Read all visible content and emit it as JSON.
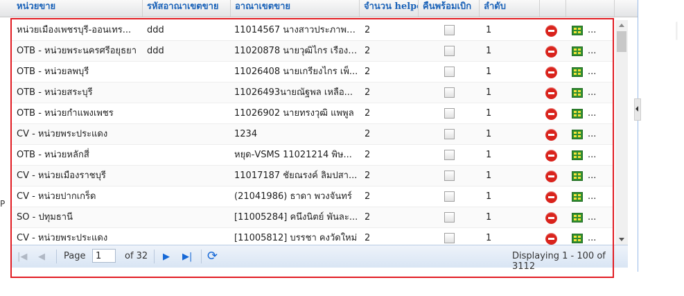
{
  "columns": [
    {
      "label": "หน่วยขาย"
    },
    {
      "label": "รหัสอาณาเขตขาย"
    },
    {
      "label": "อาณาเขตขาย"
    },
    {
      "label": "จำนวน helpe"
    },
    {
      "label": "คืนพร้อมเบิก"
    },
    {
      "label": "ลำดับ"
    }
  ],
  "rows": [
    {
      "unit": "หน่วยเมืองเพชรบุรี-ออนเทร...",
      "code": "ddd",
      "area": "11014567 นางสาวประภาพร...",
      "helper": "2",
      "order": "1"
    },
    {
      "unit": "OTB - หน่วยพระนครศรีอยุธยา",
      "code": "ddd",
      "area": "11020878 นายวุฒิไกร เรืองเ...",
      "helper": "2",
      "order": "1"
    },
    {
      "unit": "OTB - หน่วยลพบุรี",
      "code": "",
      "area": "11026408 นายเกรียงไกร เพ็...",
      "helper": "2",
      "order": "1"
    },
    {
      "unit": "OTB - หน่วยสระบุรี",
      "code": "",
      "area": "11026493นายณัฐพล เหลือ...",
      "helper": "2",
      "order": "1"
    },
    {
      "unit": "OTB - หน่วยกำแพงเพชร",
      "code": "",
      "area": "11026902 นายทรงวุฒิ แพพูล",
      "helper": "2",
      "order": "1"
    },
    {
      "unit": "CV - หน่วยพระประแดง",
      "code": "",
      "area": "1234",
      "helper": "2",
      "order": "1"
    },
    {
      "unit": "OTB - หน่วยหลักสี่",
      "code": "",
      "area": "หยุด-VSMS 11021214 พิษ...",
      "helper": "2",
      "order": "1"
    },
    {
      "unit": "CV - หน่วยเมืองราชบุรี",
      "code": "",
      "area": "11017187 ชัยณรงค์ ลิมปสา...",
      "helper": "2",
      "order": "1"
    },
    {
      "unit": "CV - หน่วยปากเกร็ด",
      "code": "",
      "area": "(21041986) ธาดา พวงจันทร์",
      "helper": "2",
      "order": "1"
    },
    {
      "unit": "SO - ปทุมธานี",
      "code": "",
      "area": "[11005284] คนึงนิตย์ พันละ...",
      "helper": "2",
      "order": "1"
    },
    {
      "unit": "CV - หน่วยพระประแดง",
      "code": "",
      "area": "[11005812] บรรชา คงวัดใหม่",
      "helper": "2",
      "order": "1"
    }
  ],
  "row_more_label": "...",
  "pager": {
    "page_label": "Page",
    "page_value": "1",
    "of_label": "of 32",
    "display_text": "Displaying 1 - 100 of 3112"
  },
  "icons": {
    "delete": "delete-icon",
    "edit": "edit-grid-icon",
    "first": "first-page-icon",
    "prev": "prev-page-icon",
    "next": "next-page-icon",
    "last": "last-page-icon",
    "refresh": "refresh-icon"
  },
  "colors": {
    "header_text": "#1a62b8",
    "highlight_border": "#e11b22",
    "delete": "#d9231c"
  }
}
